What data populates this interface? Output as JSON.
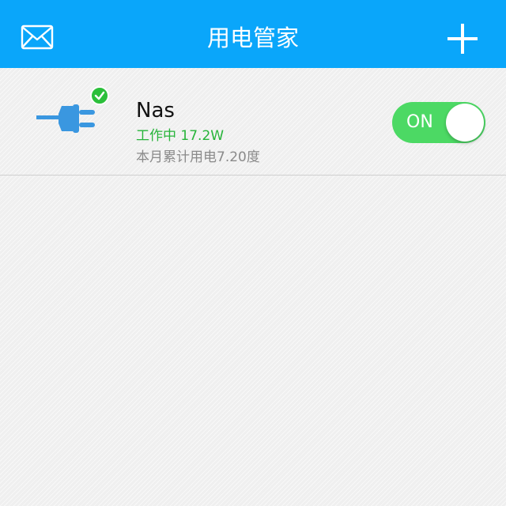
{
  "header": {
    "title": "用电管家",
    "mail_icon": "mail-icon",
    "add_icon": "plus-icon",
    "background_color": "#0aa6fa"
  },
  "devices": [
    {
      "name": "Nas",
      "status": "工作中 17.2W",
      "usage": "本月累计用电7.20度",
      "icon": "power-plug-icon",
      "badge_icon": "check-icon",
      "switch_label": "ON",
      "switch_on": true,
      "status_color": "#27b43a",
      "switch_color": "#4cd964"
    }
  ]
}
